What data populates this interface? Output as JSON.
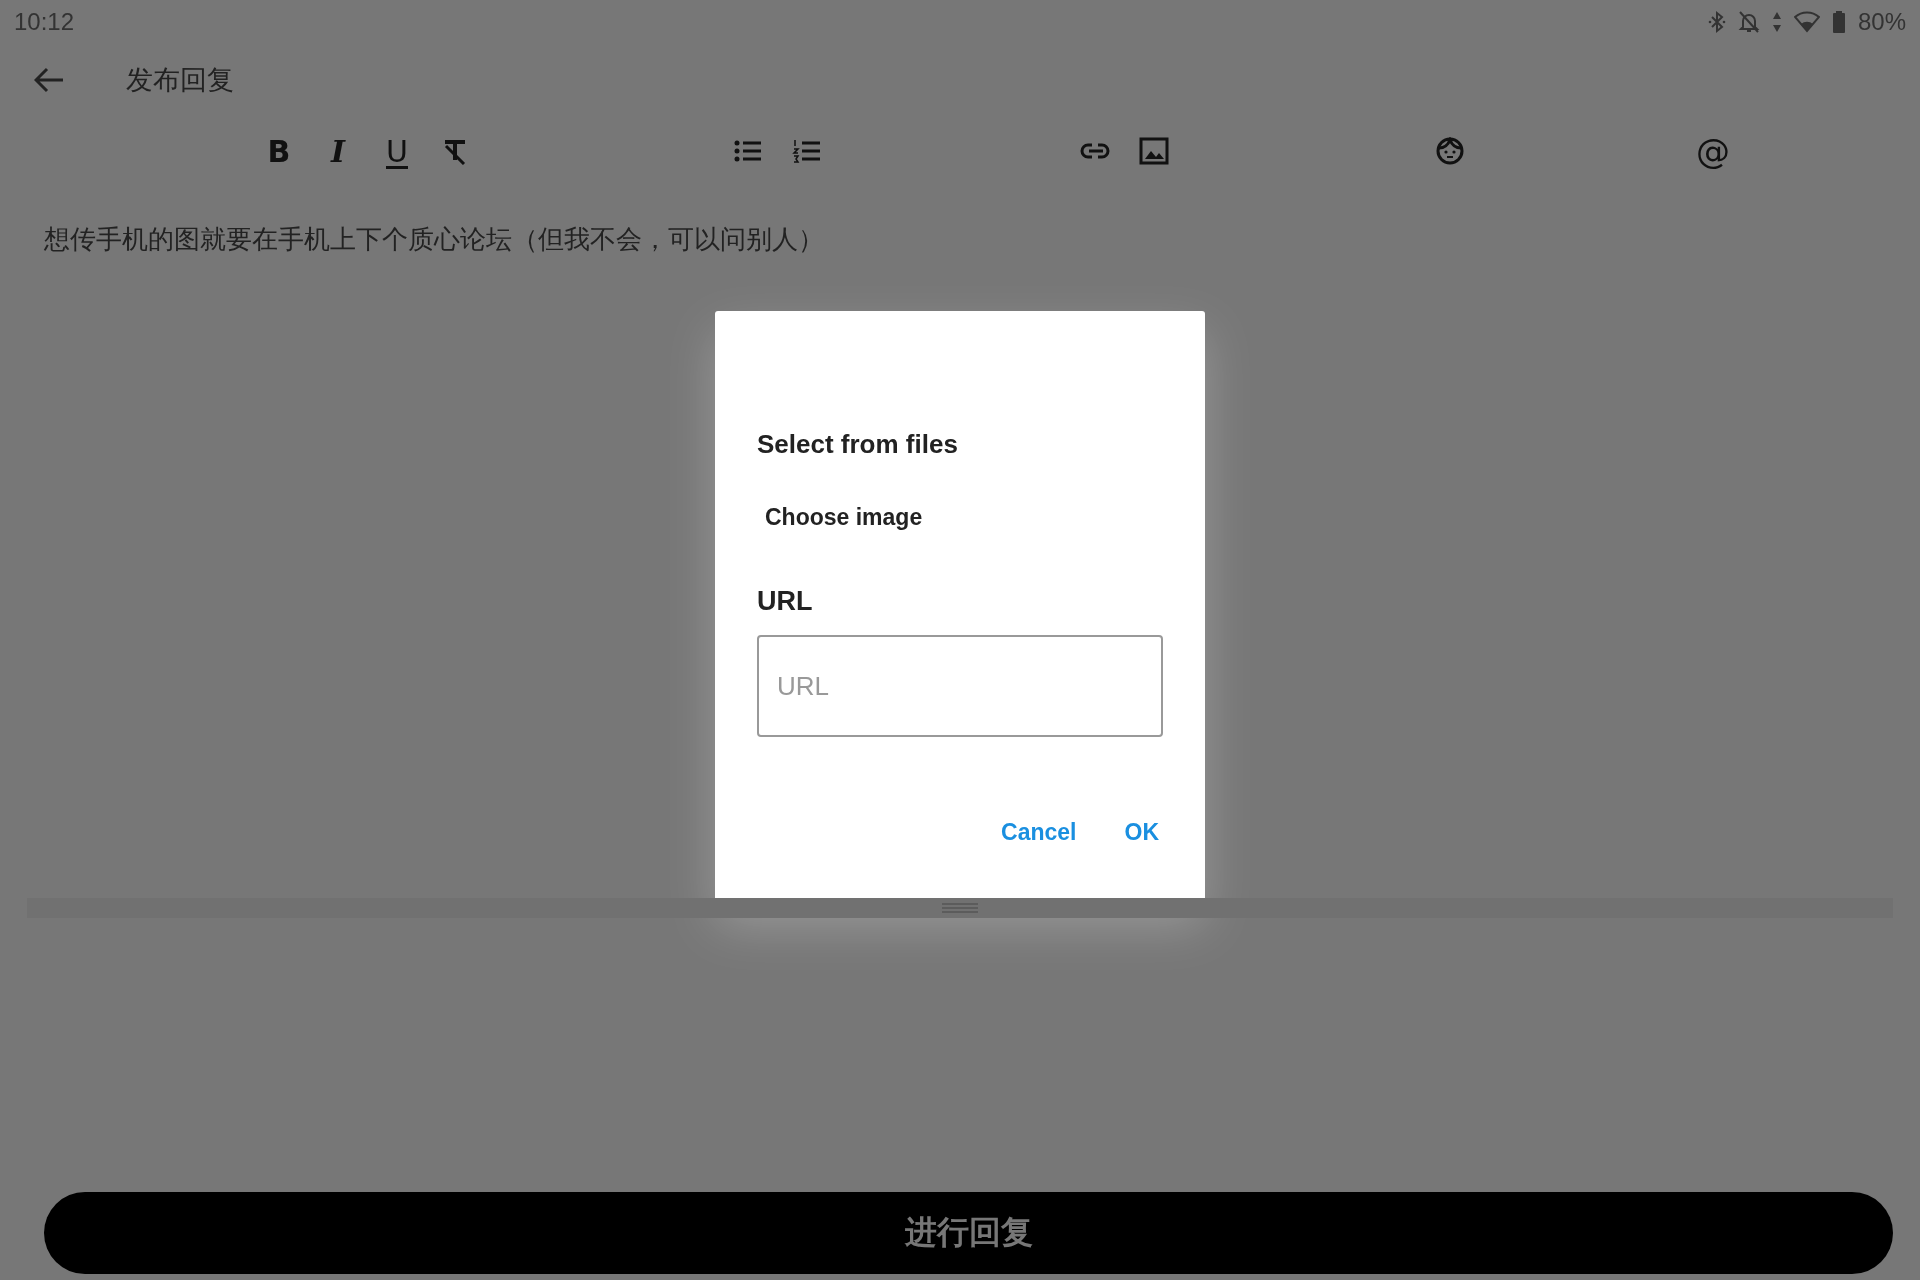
{
  "status_bar": {
    "time": "10:12",
    "battery": "80%"
  },
  "header": {
    "title": "发布回复"
  },
  "toolbar": {
    "groups": [
      [
        {
          "kind": "bold",
          "label": "B"
        },
        {
          "kind": "italic",
          "label": "I"
        },
        {
          "kind": "underline",
          "label": "U"
        },
        {
          "kind": "clear-format"
        }
      ],
      [
        {
          "kind": "bullet-list"
        },
        {
          "kind": "numbered-list"
        }
      ],
      [
        {
          "kind": "link"
        },
        {
          "kind": "image"
        }
      ],
      [
        {
          "kind": "emoji"
        }
      ],
      [
        {
          "kind": "mention",
          "label": "@"
        }
      ]
    ]
  },
  "editor": {
    "text": "想传手机的图就要在手机上下个质心论坛（但我不会，可以问别人）"
  },
  "dialog": {
    "section_title": "Select from files",
    "choose_button": "Choose image",
    "url_label": "URL",
    "url_field": {
      "placeholder": "URL"
    },
    "buttons": [
      "Cancel",
      "OK"
    ]
  },
  "submit_button": "进行回复"
}
